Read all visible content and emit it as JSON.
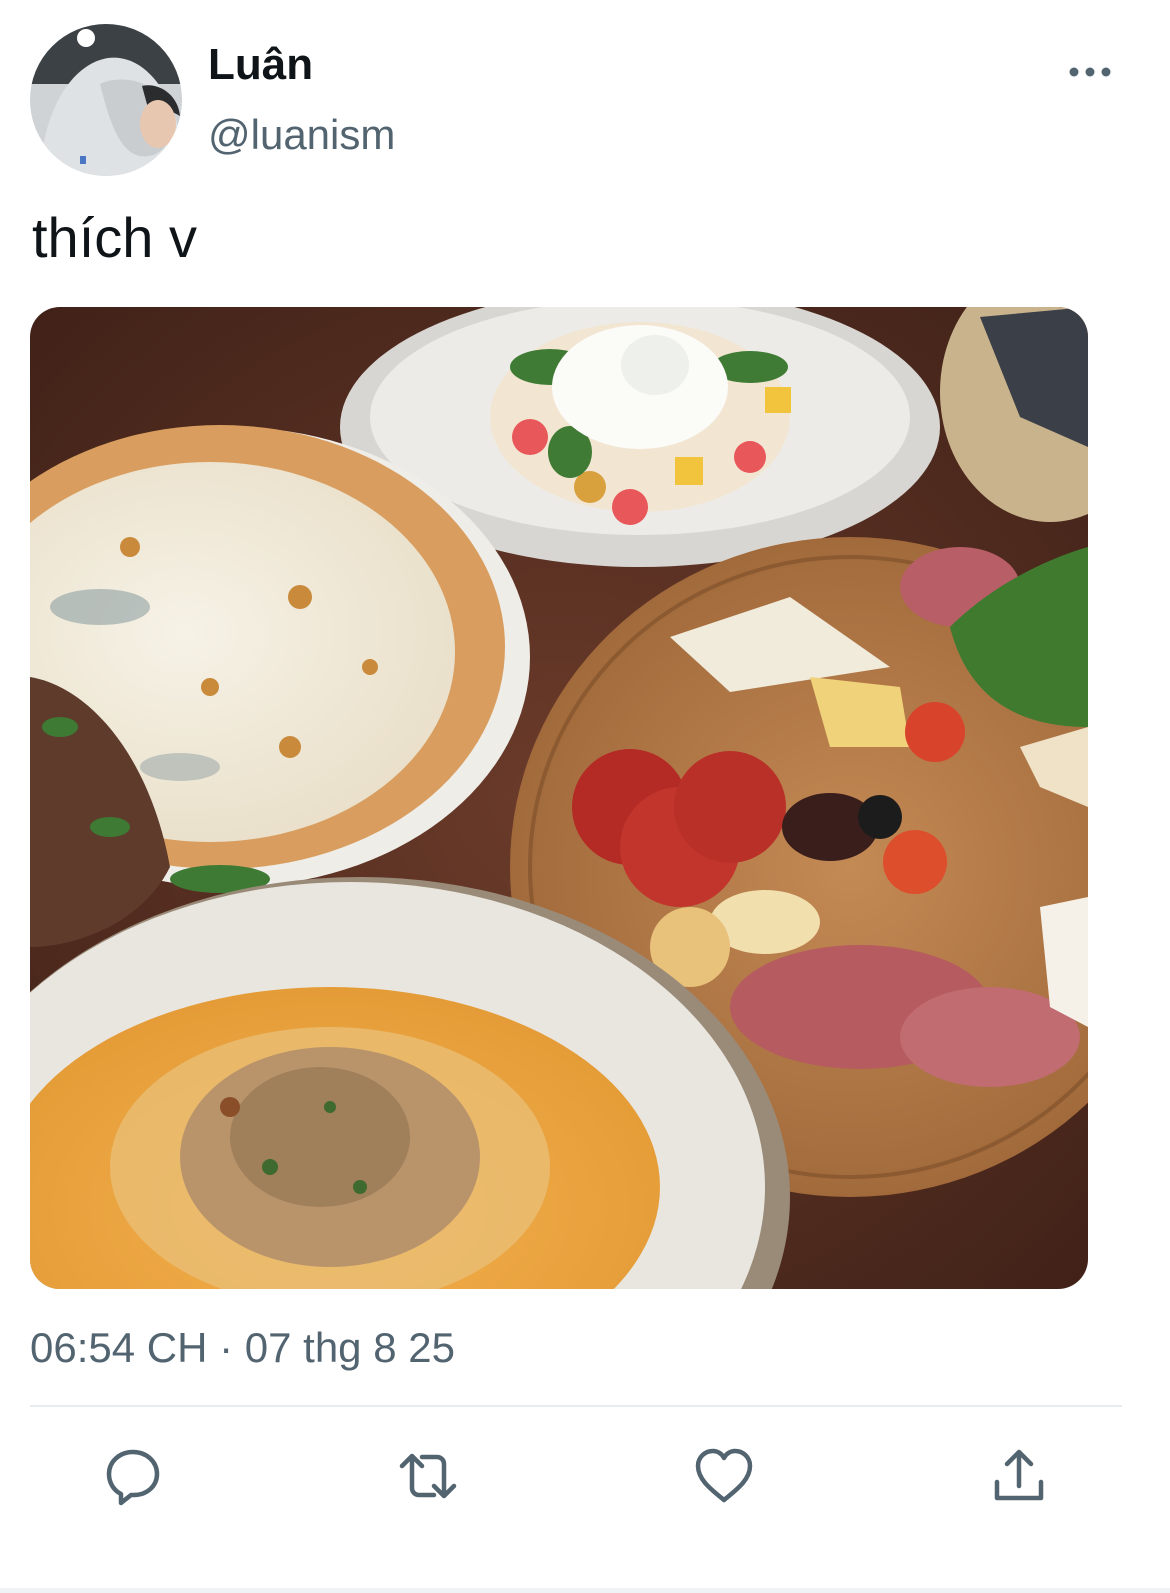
{
  "author": {
    "name": "Luân",
    "handle": "@luanism"
  },
  "tweet": {
    "text": "thích v",
    "timestamp": "06:54 CH · 07 thg 8 25"
  },
  "icons": {
    "more": "more-horizontal-icon",
    "reply": "reply-icon",
    "retweet": "retweet-icon",
    "like": "heart-icon",
    "share": "share-icon"
  },
  "colors": {
    "text_primary": "#0f1419",
    "text_secondary": "#536471",
    "icon": "#536471",
    "divider": "#e7ecf0"
  }
}
